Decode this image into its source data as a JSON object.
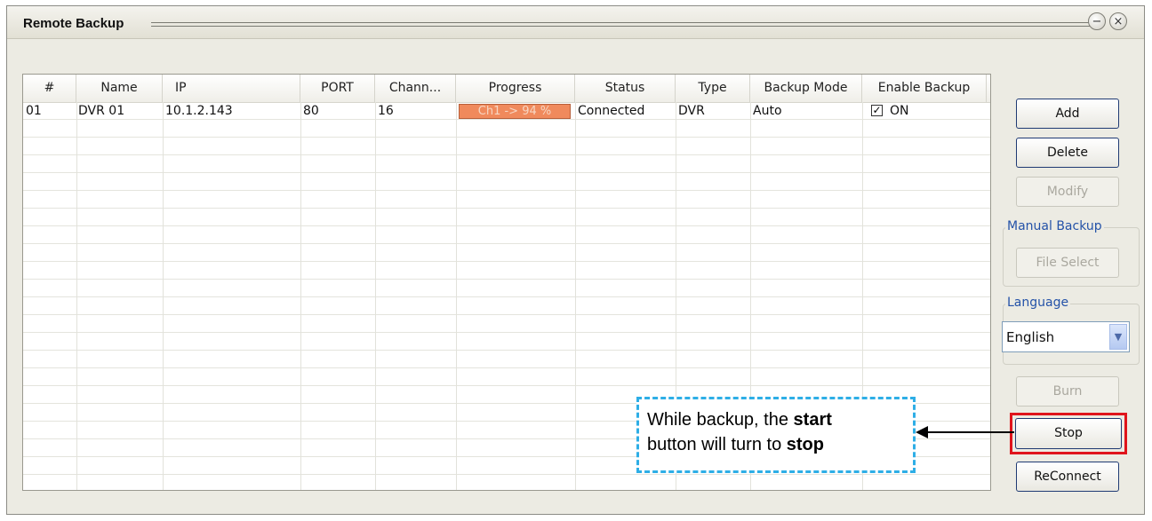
{
  "window": {
    "title": "Remote Backup"
  },
  "table": {
    "headers": [
      "#",
      "Name",
      "IP",
      "PORT",
      "Chann...",
      "Progress",
      "Status",
      "Type",
      "Backup Mode",
      "Enable Backup"
    ],
    "rows": [
      {
        "num": "01",
        "name": "DVR 01",
        "ip": "10.1.2.143",
        "port": "80",
        "channels": "16",
        "progress": "Ch1 -> 94 %",
        "progress_percent": 94,
        "status": "Connected",
        "type": "DVR",
        "backup_mode": "Auto",
        "enable_backup": "ON",
        "enable_checked": true
      }
    ]
  },
  "buttons": {
    "add": "Add",
    "delete": "Delete",
    "modify": "Modify",
    "file_select": "File Select",
    "burn": "Burn",
    "stop": "Stop",
    "reconnect": "ReConnect"
  },
  "groups": {
    "manual_backup": "Manual Backup",
    "language": "Language"
  },
  "language_select": {
    "value": "English"
  },
  "annotation": {
    "line1_pre": "While backup, the ",
    "line1_bold": "start",
    "line2_pre": "button will turn to ",
    "line2_bold": "stop"
  },
  "colors": {
    "progress_fill": "#f08a5c",
    "highlight": "#e0141c",
    "callout_border": "#2eaee6",
    "group_label": "#2452a8"
  }
}
